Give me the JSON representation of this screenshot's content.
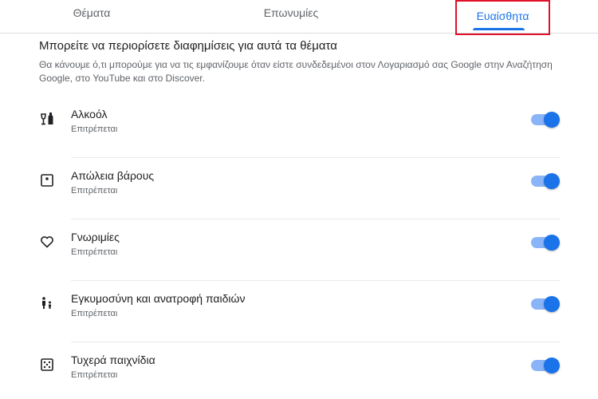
{
  "tabs": {
    "topics": "Θέματα",
    "names": "Επωνυμίες",
    "sensitive": "Ευαίσθητα"
  },
  "section": {
    "title": "Μπορείτε να περιορίσετε διαφημίσεις για αυτά τα θέματα",
    "description": "Θα κάνουμε ό,τι μπορούμε για να τις εμφανίζουμε όταν είστε συνδεδεμένοι στον Λογαριασμό σας Google στην Αναζήτηση Google, στο YouTube και στο Discover."
  },
  "items": [
    {
      "label": "Αλκοόλ",
      "status": "Επιτρέπεται",
      "icon": "alcohol-icon",
      "enabled": true
    },
    {
      "label": "Απώλεια βάρους",
      "status": "Επιτρέπεται",
      "icon": "scale-icon",
      "enabled": true
    },
    {
      "label": "Γνωριμίες",
      "status": "Επιτρέπεται",
      "icon": "heart-icon",
      "enabled": true
    },
    {
      "label": "Εγκυμοσύνη και ανατροφή παιδιών",
      "status": "Επιτρέπεται",
      "icon": "family-icon",
      "enabled": true
    },
    {
      "label": "Τυχερά παιχνίδια",
      "status": "Επιτρέπεται",
      "icon": "dice-icon",
      "enabled": true
    }
  ],
  "colors": {
    "accent": "#1a73e8",
    "highlight_box": "#e0102a"
  }
}
